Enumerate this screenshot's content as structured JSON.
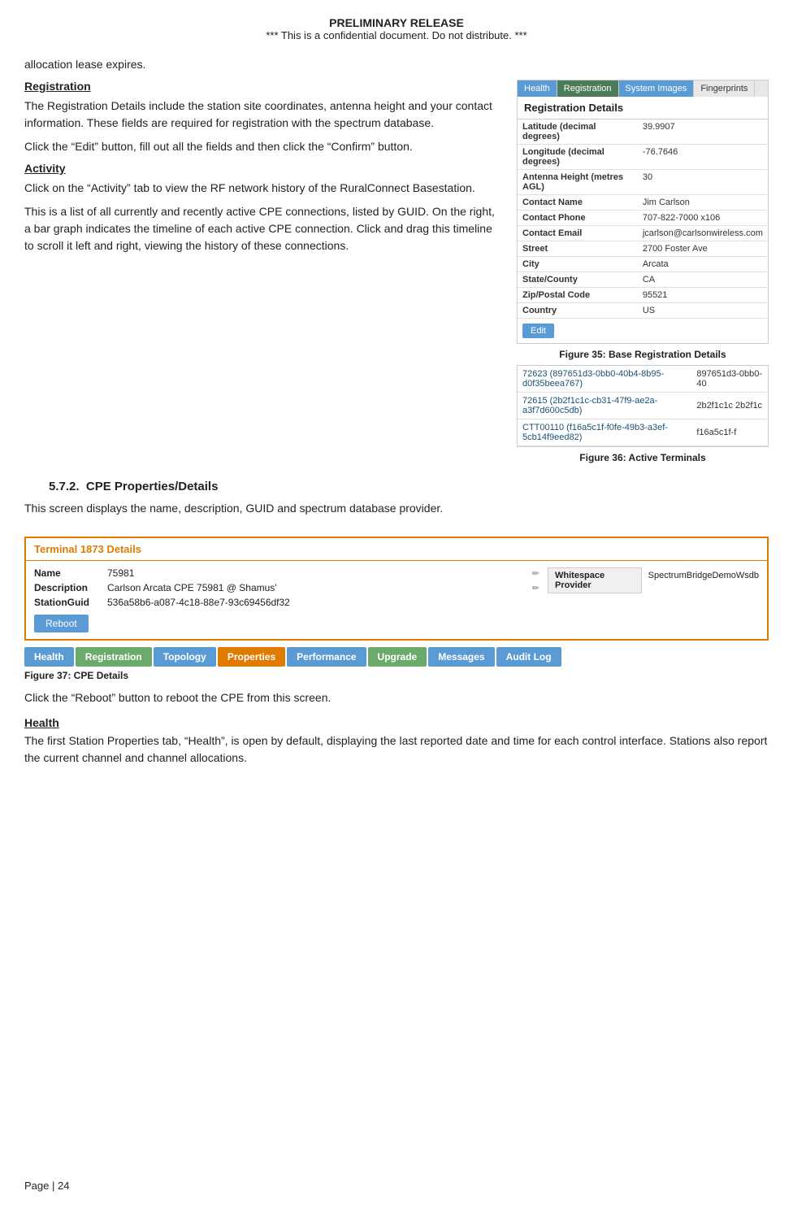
{
  "header": {
    "line1": "PRELIMINARY RELEASE",
    "line2": "*** This is a confidential document. Do not distribute. ***"
  },
  "intro_text": "allocation lease expires.",
  "registration": {
    "heading": "Registration",
    "para1": "The Registration Details include the station site coordinates, antenna height and your contact information. These fields are required for registration with the spectrum database.",
    "para2": "Click the “Edit” button, fill out all the fields and then click the “Confirm” button."
  },
  "activity": {
    "heading": "Activity",
    "para1": "Click on the “Activity” tab to view the RF network history of the RuralConnect Basestation.",
    "para2": "This is a list of all currently and recently active CPE connections, listed by GUID. On the right, a bar graph indicates the timeline of each active CPE connection. Click and drag this timeline to scroll it left and right, viewing the history of these connections."
  },
  "reg_panel": {
    "tabs": [
      {
        "label": "Health",
        "class": "active-health"
      },
      {
        "label": "Registration",
        "class": "active-reg"
      },
      {
        "label": "System Images",
        "class": "active-sysimg"
      },
      {
        "label": "Fingerprints",
        "class": "inactive"
      }
    ],
    "title": "Registration Details",
    "rows": [
      {
        "label": "Latitude (decimal degrees)",
        "value": "39.9907"
      },
      {
        "label": "Longitude (decimal degrees)",
        "value": "-76.7646"
      },
      {
        "label": "Antenna Height (metres AGL)",
        "value": "30"
      },
      {
        "label": "Contact Name",
        "value": "Jim Carlson"
      },
      {
        "label": "Contact Phone",
        "value": "707-822-7000 x106"
      },
      {
        "label": "Contact Email",
        "value": "jcarlson@carlsonwireless.com"
      },
      {
        "label": "Street",
        "value": "2700 Foster Ave"
      },
      {
        "label": "City",
        "value": "Arcata"
      },
      {
        "label": "State/County",
        "value": "CA"
      },
      {
        "label": "Zip/Postal Code",
        "value": "95521"
      },
      {
        "label": "Country",
        "value": "US"
      }
    ],
    "edit_btn": "Edit"
  },
  "fig35_caption": "Figure 35: Base Registration Details",
  "terminals": {
    "rows": [
      {
        "guid_full": "72623 (897651d3-0bb0-40b4-8b95-d0f35beea767)",
        "guid_short": "897651d3-0bb0-40"
      },
      {
        "guid_full": "72615 (2b2f1c1c-cb31-47f9-ae2a-a3f7d600c5db)",
        "guid_short": "2b2f1c1c  2b2f1c"
      },
      {
        "guid_full": "CTT00110 (f16a5c1f-f0fe-49b3-a3ef-5cb14f9eed82)",
        "guid_short": "f16a5c1f-f"
      }
    ]
  },
  "fig36_caption": "Figure 36: Active Terminals",
  "subsection": {
    "number": "5.7.2.",
    "title": "CPE Properties/Details"
  },
  "screen_desc": "This screen displays the name, description, GUID and spectrum database provider.",
  "terminal_details": {
    "header_label": "Terminal 1873 Details",
    "name_label": "Name",
    "name_value": "75981",
    "desc_label": "Description",
    "desc_value": "Carlson Arcata CPE 75981 @ Shamus'",
    "guid_label": "StationGuid",
    "guid_value": "536a58b6-a087-4c18-88e7-93c69456df32",
    "ws_provider_label": "Whitespace Provider",
    "ws_provider_value": "SpectrumBridgeDemoWsdb",
    "reboot_btn": "Reboot"
  },
  "cpe_tabs": [
    {
      "label": "Health",
      "class": "cpe-tab-health"
    },
    {
      "label": "Registration",
      "class": "cpe-tab-reg"
    },
    {
      "label": "Topology",
      "class": "cpe-tab-topo"
    },
    {
      "label": "Properties",
      "class": "cpe-tab-props"
    },
    {
      "label": "Performance",
      "class": "cpe-tab-perf"
    },
    {
      "label": "Upgrade",
      "class": "cpe-tab-upgrade"
    },
    {
      "label": "Messages",
      "class": "cpe-tab-msg"
    },
    {
      "label": "Audit Log",
      "class": "cpe-tab-audit"
    }
  ],
  "fig37_caption": "Figure 37: CPE Details",
  "reboot_text": "Click the “Reboot” button to reboot the CPE from this screen.",
  "health_heading": "Health",
  "health_para": "The first Station Properties tab, “Health”, is open by default, displaying the last reported date and time for each control interface.  Stations also report the current channel and channel allocations.",
  "footer": "Page | 24"
}
